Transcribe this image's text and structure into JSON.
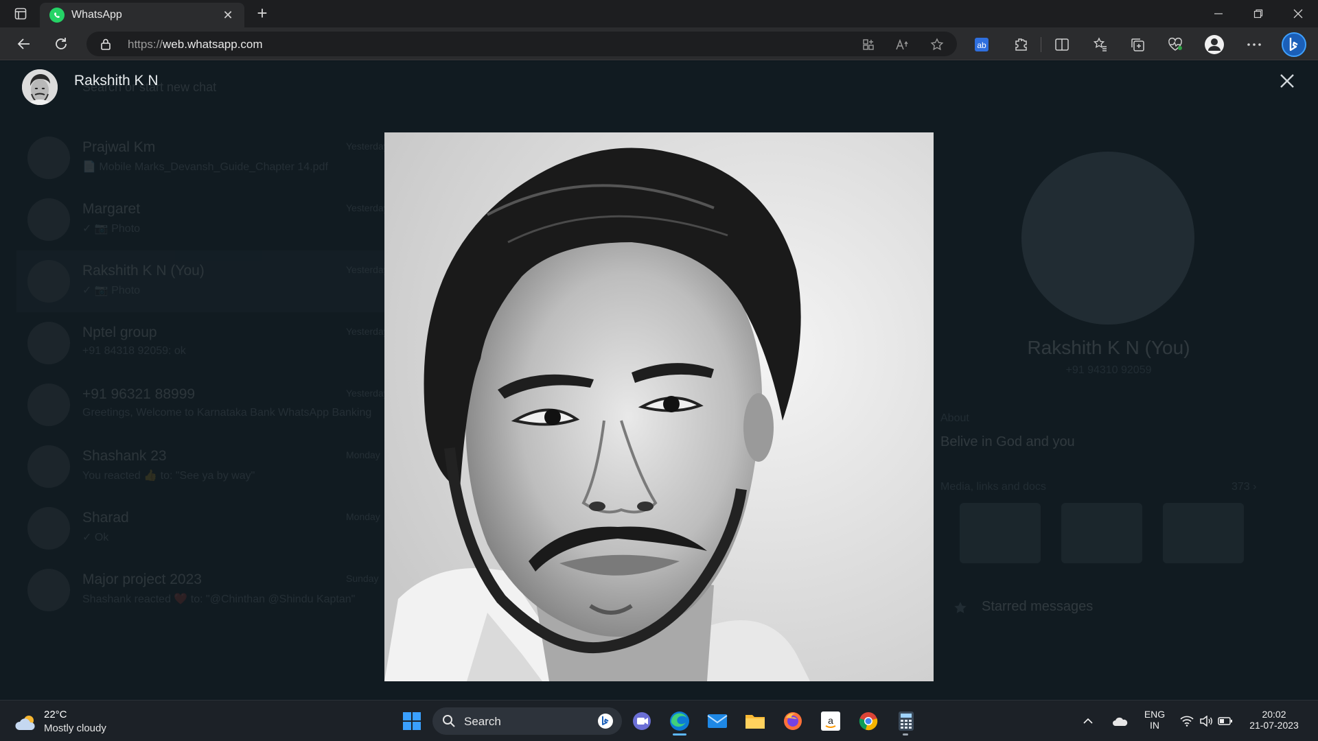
{
  "browser": {
    "tab_title": "WhatsApp",
    "url_prefix": "https://",
    "url_host": "web.whatsapp.com"
  },
  "background": {
    "search_placeholder": "Search or start new chat",
    "chats": [
      {
        "name": "Prajwal Km",
        "preview": "📄 Mobile Marks_Devansh_Guide_Chapter 14.pdf",
        "time": "Yesterday"
      },
      {
        "name": "Margaret",
        "preview": "✓ 📷 Photo",
        "time": "Yesterday"
      },
      {
        "name": "Rakshith K N (You)",
        "preview": "✓ 📷 Photo",
        "time": "Yesterday"
      },
      {
        "name": "Nptel group",
        "preview": "+91 84318 92059: ok",
        "time": "Yesterday"
      },
      {
        "name": "+91 96321 88999",
        "preview": "Greetings, Welcome to Karnataka Bank WhatsApp Banking",
        "time": "Yesterday"
      },
      {
        "name": "Shashank 23",
        "preview": "You reacted 👍 to: \"See ya by way\"",
        "time": "Monday"
      },
      {
        "name": "Sharad",
        "preview": "✓ Ok",
        "time": "Monday"
      },
      {
        "name": "Major project 2023",
        "preview": "Shashank reacted ❤️ to: \"@Chinthan @Shindu Kaptan\"",
        "time": "Sunday"
      }
    ],
    "info": {
      "name": "Rakshith K N (You)",
      "phone": "+91 94310 92059",
      "about_heading": "About",
      "about": "Belive in God and you",
      "media_heading": "Media, links and docs",
      "media_count": "373 ›",
      "starred": "Starred messages"
    }
  },
  "viewer": {
    "contact_name": "Rakshith K N"
  },
  "taskbar": {
    "temperature": "22°C",
    "weather": "Mostly cloudy",
    "search_label": "Search",
    "lang_top": "ENG",
    "lang_bottom": "IN",
    "time": "20:02",
    "date": "21-07-2023"
  },
  "colors": {
    "whatsapp_green": "#25d366",
    "viewer_bg": "#111b21",
    "taskbar_bg": "#1c2127"
  }
}
